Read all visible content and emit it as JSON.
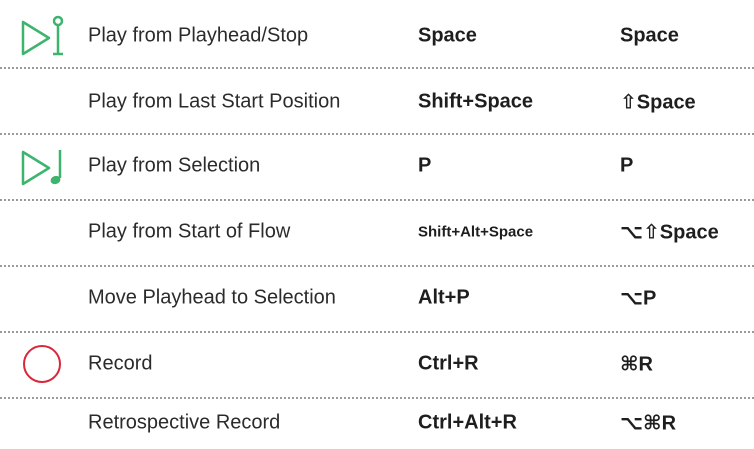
{
  "colors": {
    "play_icon": "#3db46d",
    "record_icon": "#d8283b",
    "divider": "#9a9a9a"
  },
  "rows": [
    {
      "icon": "play-playhead-icon",
      "action": "Play from Playhead/Stop",
      "windows": "Space",
      "mac": "Space"
    },
    {
      "icon": "",
      "action": "Play from Last Start Position",
      "windows": "Shift+Space",
      "mac": "⇧Space"
    },
    {
      "icon": "play-selection-icon",
      "action": "Play from Selection",
      "windows": "P",
      "mac": "P"
    },
    {
      "icon": "",
      "action": "Play from Start of Flow",
      "windows": "Shift+Alt+Space",
      "mac": "⌥⇧Space"
    },
    {
      "icon": "",
      "action": "Move Playhead to Selection",
      "windows": "Alt+P",
      "mac": "⌥P"
    },
    {
      "icon": "record-icon",
      "action": "Record",
      "windows": "Ctrl+R",
      "mac": "⌘R"
    },
    {
      "icon": "",
      "action": "Retrospective Record",
      "windows": "Ctrl+Alt+R",
      "mac": "⌥⌘R"
    }
  ]
}
